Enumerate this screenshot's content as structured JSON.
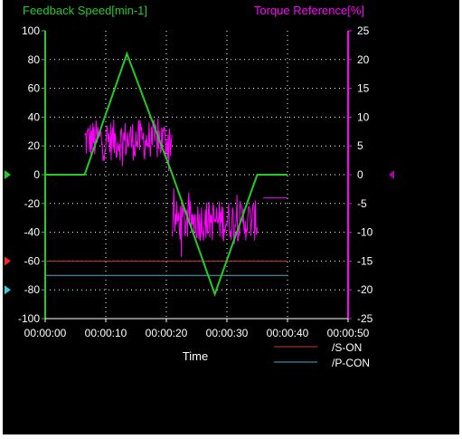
{
  "chart_data": {
    "type": "line",
    "left_axis_label": "Feedback Speed[min-1]",
    "right_axis_label": "Torque Reference[%]",
    "xlabel": "Time",
    "x_ticks": [
      "00:00:00",
      "00:00:10",
      "00:00:20",
      "00:00:30",
      "00:00:40",
      "00:00:50"
    ],
    "x_range_s": [
      0,
      50
    ],
    "left_ticks": [
      "100",
      "80",
      "60",
      "40",
      "20",
      "0",
      "-20",
      "-40",
      "-60",
      "-80",
      "-100"
    ],
    "left_range": [
      -100,
      100
    ],
    "right_ticks": [
      "25",
      "20",
      "15",
      "10",
      "5",
      "0",
      "-5",
      "-10",
      "-15",
      "-20",
      "-25"
    ],
    "right_range": [
      -25,
      25
    ],
    "grid": true,
    "series": [
      {
        "name": "Feedback Speed",
        "axis": "left",
        "color": "#22cc22",
        "x": [
          0,
          6.5,
          13.5,
          21,
          28,
          35,
          40
        ],
        "y": [
          0,
          0,
          84,
          0,
          -83,
          0,
          0
        ]
      },
      {
        "name": "Torque Reference",
        "axis": "right",
        "color": "#ff00ff",
        "style": "noisy",
        "segments": [
          {
            "x": [
              6.5,
              21
            ],
            "center": 6,
            "amplitude": 4.5
          },
          {
            "x": [
              21,
              35
            ],
            "center": -8,
            "amplitude": 4.5
          },
          {
            "x": [
              36,
              40
            ],
            "center": -4,
            "amplitude": 0
          }
        ]
      },
      {
        "name": "/S-ON",
        "axis": "left",
        "color": "#cc3333",
        "x": [
          0,
          40
        ],
        "y": [
          -60,
          -60
        ]
      },
      {
        "name": "/P-CON",
        "axis": "left",
        "color": "#44aacc",
        "x": [
          0,
          40
        ],
        "y": [
          -70,
          -70
        ]
      }
    ],
    "legend": [
      {
        "label": "/S-ON",
        "color": "#cc3333"
      },
      {
        "label": "/P-CON",
        "color": "#44aacc"
      }
    ],
    "markers": [
      {
        "name": "speed-zero-marker",
        "value": 0,
        "color": "#22cc22"
      },
      {
        "name": "s-on-marker",
        "value": -60,
        "color": "#ff2222"
      },
      {
        "name": "p-con-marker",
        "value": -80,
        "color": "#33ccdd"
      },
      {
        "name": "torque-zero-marker",
        "value": 0,
        "color": "#aa00aa"
      }
    ]
  }
}
